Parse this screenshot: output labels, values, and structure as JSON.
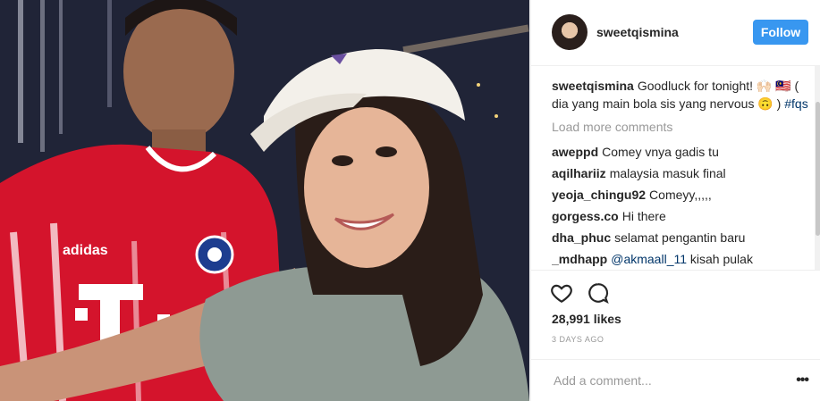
{
  "post": {
    "username": "sweetqismina",
    "follow_label": "Follow",
    "caption_user": "sweetqismina",
    "caption_text": "Goodluck for tonight! 🙌🏻 🇲🇾 ( dia yang main bola sis yang nervous 🙃 )",
    "caption_hashtag": "#fqs",
    "load_more": "Load more comments",
    "comments": [
      {
        "user": "aweppd",
        "text": "Comey vnya gadis tu"
      },
      {
        "user": "aqilhariiz",
        "text": "malaysia masuk final"
      },
      {
        "user": "yeoja_chingu92",
        "text": "Comeyy,,,,,"
      },
      {
        "user": "gorgess.co",
        "text": "Hi there"
      },
      {
        "user": "dha_phuc",
        "text": "selamat pengantin baru"
      },
      {
        "user": "_mdhapp",
        "mention": "@akmaall_11",
        "text": "kisah pulak"
      }
    ],
    "likes": "28,991 likes",
    "date": "3 DAYS AGO",
    "add_comment_placeholder": "Add a comment...",
    "more_options": "•••"
  },
  "photo": {
    "jersey_text": "T · ·",
    "brand": "adidas",
    "club": "FC BAYERN MÜNCHEN"
  },
  "colors": {
    "accent": "#3897f0",
    "jersey_red": "#d4142c",
    "text": "#262626",
    "muted": "#999999"
  },
  "icons": [
    "heart-icon",
    "comment-icon",
    "more-options-icon",
    "avatar"
  ]
}
